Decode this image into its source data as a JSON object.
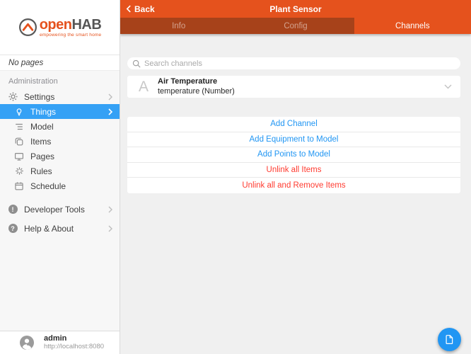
{
  "colors": {
    "brand_orange": "#e5521d",
    "tab_inactive_bg": "#a7421a",
    "accent_blue": "#2196f3",
    "sidebar_selected_blue": "#35a1f5",
    "danger_red": "#ff3b30"
  },
  "topbar": {
    "back_label": "Back",
    "title": "Plant Sensor"
  },
  "tabs": [
    {
      "label": "Info",
      "active": false
    },
    {
      "label": "Config",
      "active": false
    },
    {
      "label": "Channels",
      "active": true
    }
  ],
  "sidebar": {
    "logo": {
      "brand_open": "open",
      "brand_hab": "HAB",
      "tagline": "empowering the smart home"
    },
    "no_pages_label": "No pages",
    "section_label": "Administration",
    "items": [
      {
        "label": "Settings",
        "icon": "gear-icon",
        "chevron": true,
        "selected": false
      },
      {
        "label": "Things",
        "icon": "lightbulb-icon",
        "chevron": true,
        "selected": true
      },
      {
        "label": "Model",
        "icon": "model-tree-icon",
        "chevron": false,
        "selected": false
      },
      {
        "label": "Items",
        "icon": "items-copy-icon",
        "chevron": false,
        "selected": false
      },
      {
        "label": "Pages",
        "icon": "pages-monitor-icon",
        "chevron": false,
        "selected": false
      },
      {
        "label": "Rules",
        "icon": "rules-spark-icon",
        "chevron": false,
        "selected": false
      },
      {
        "label": "Schedule",
        "icon": "schedule-calendar-icon",
        "chevron": false,
        "selected": false
      }
    ],
    "secondary_items": [
      {
        "label": "Developer Tools",
        "icon": "developer-tools-icon",
        "badge_glyph": "!",
        "chevron": true
      },
      {
        "label": "Help & About",
        "icon": "help-icon",
        "badge_glyph": "?",
        "chevron": true
      }
    ],
    "footer": {
      "username": "admin",
      "server_url": "http://localhost:8080"
    }
  },
  "main": {
    "search": {
      "placeholder": "Search channels"
    },
    "channel_list": [
      {
        "initial": "A",
        "name": "Air Temperature",
        "description": "temperature (Number)"
      }
    ],
    "actions": [
      {
        "label": "Add Channel",
        "style": "blue"
      },
      {
        "label": "Add Equipment to Model",
        "style": "blue"
      },
      {
        "label": "Add Points to Model",
        "style": "blue"
      },
      {
        "label": "Unlink all Items",
        "style": "red"
      },
      {
        "label": "Unlink all and Remove Items",
        "style": "red"
      }
    ],
    "fab": {
      "icon": "document-icon"
    }
  }
}
